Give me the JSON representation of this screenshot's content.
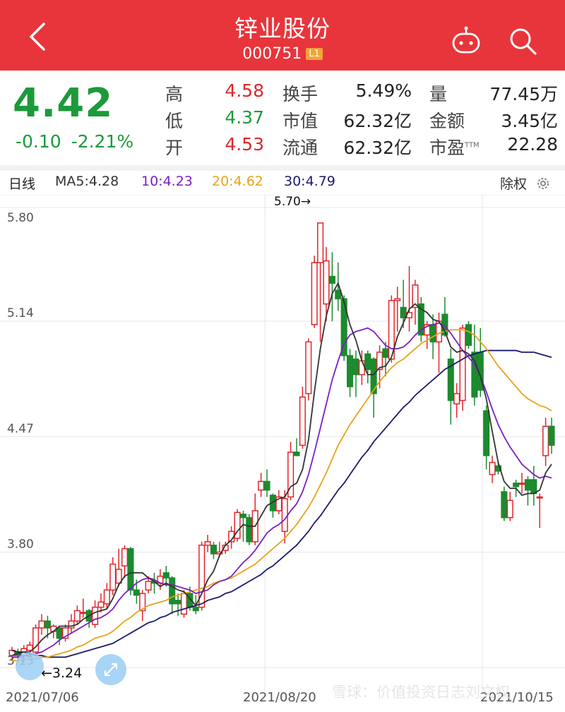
{
  "header": {
    "title": "锌业股份",
    "code": "000751",
    "badge": "L1",
    "bg_color": "#e8353b"
  },
  "quote": {
    "price": "4.42",
    "change": "-0.10",
    "change_pct": "-2.21%",
    "stats": [
      {
        "label": "高",
        "value": "4.58",
        "color": "red"
      },
      {
        "label": "低",
        "value": "4.37",
        "color": "green"
      },
      {
        "label": "开",
        "value": "4.53",
        "color": "red"
      },
      {
        "label": "换手",
        "value": "5.49%",
        "color": "black"
      },
      {
        "label": "市值",
        "value": "62.32亿",
        "color": "black"
      },
      {
        "label": "流通",
        "value": "62.32亿",
        "color": "black"
      },
      {
        "label": "量",
        "value": "77.45万",
        "color": "black"
      },
      {
        "label": "金额",
        "value": "3.45亿",
        "color": "black"
      },
      {
        "label": "市盈",
        "value": "22.28",
        "color": "black",
        "sup": "TTM"
      }
    ]
  },
  "legend": {
    "period": "日线",
    "ma5": "MA5:4.28",
    "ma10": "10:4.23",
    "ma20": "20:4.62",
    "ma30": "30:4.79",
    "adjust": "除权"
  },
  "watermark": "雪球：价值投资日志刘文权",
  "chart_data": {
    "type": "candlestick",
    "y_ticks": [
      "5.80",
      "5.14",
      "4.47",
      "3.80",
      "3.13"
    ],
    "ylim": [
      3.13,
      5.8
    ],
    "x_labels": [
      "2021/07/06",
      "2021/08/20",
      "2021/10/15"
    ],
    "high_marker": "5.70→",
    "low_marker": "←3.24",
    "colors": {
      "up": "#e0262d",
      "down": "#1c8a2e",
      "ma5": "#333333",
      "ma10": "#7b1fc2",
      "ma20": "#e8a317",
      "ma30": "#1a1a6e"
    },
    "candles": [
      [
        3.2,
        3.23,
        3.25,
        3.17
      ],
      [
        3.22,
        3.2,
        3.24,
        3.16
      ],
      [
        3.2,
        3.24,
        3.26,
        3.16
      ],
      [
        3.23,
        3.26,
        3.28,
        3.19
      ],
      [
        3.22,
        3.36,
        3.38,
        3.21
      ],
      [
        3.36,
        3.4,
        3.44,
        3.32
      ],
      [
        3.4,
        3.36,
        3.43,
        3.3
      ],
      [
        3.34,
        3.37,
        3.38,
        3.3
      ],
      [
        3.36,
        3.3,
        3.37,
        3.26
      ],
      [
        3.3,
        3.36,
        3.38,
        3.28
      ],
      [
        3.36,
        3.4,
        3.44,
        3.33
      ],
      [
        3.4,
        3.46,
        3.49,
        3.38
      ],
      [
        3.45,
        3.45,
        3.53,
        3.42
      ],
      [
        3.46,
        3.4,
        3.47,
        3.36
      ],
      [
        3.38,
        3.48,
        3.52,
        3.36
      ],
      [
        3.48,
        3.51,
        3.56,
        3.45
      ],
      [
        3.5,
        3.58,
        3.62,
        3.47
      ],
      [
        3.58,
        3.73,
        3.77,
        3.55
      ],
      [
        3.62,
        3.7,
        3.82,
        3.6
      ],
      [
        3.72,
        3.82,
        3.84,
        3.65
      ],
      [
        3.82,
        3.58,
        3.83,
        3.55
      ],
      [
        3.58,
        3.55,
        3.64,
        3.5
      ],
      [
        3.46,
        3.56,
        3.58,
        3.4
      ],
      [
        3.58,
        3.63,
        3.66,
        3.56
      ],
      [
        3.63,
        3.62,
        3.68,
        3.56
      ],
      [
        3.62,
        3.66,
        3.7,
        3.58
      ],
      [
        3.68,
        3.65,
        3.72,
        3.6
      ],
      [
        3.65,
        3.5,
        3.66,
        3.44
      ],
      [
        3.52,
        3.5,
        3.56,
        3.43
      ],
      [
        3.44,
        3.56,
        3.58,
        3.42
      ],
      [
        3.56,
        3.48,
        3.6,
        3.46
      ],
      [
        3.48,
        3.46,
        3.55,
        3.44
      ],
      [
        3.48,
        3.84,
        3.86,
        3.46
      ],
      [
        3.84,
        3.86,
        3.9,
        3.8
      ],
      [
        3.84,
        3.79,
        3.86,
        3.76
      ],
      [
        3.79,
        3.8,
        3.86,
        3.77
      ],
      [
        3.81,
        3.84,
        3.86,
        3.79
      ],
      [
        3.86,
        3.92,
        3.95,
        3.82
      ],
      [
        3.88,
        4.03,
        4.05,
        3.86
      ],
      [
        4.02,
        4.0,
        4.04,
        3.86
      ],
      [
        4.0,
        3.86,
        4.02,
        3.84
      ],
      [
        3.86,
        4.04,
        4.14,
        3.84
      ],
      [
        4.16,
        4.21,
        4.26,
        4.12
      ],
      [
        4.21,
        4.16,
        4.28,
        4.12
      ],
      [
        4.13,
        4.04,
        4.14,
        4.0
      ],
      [
        4.04,
        4.12,
        4.16,
        4.02
      ],
      [
        3.92,
        4.11,
        4.16,
        3.85
      ],
      [
        4.12,
        4.38,
        4.44,
        4.1
      ],
      [
        4.38,
        4.36,
        4.46,
        4.36
      ],
      [
        4.42,
        4.7,
        4.76,
        4.4
      ],
      [
        4.72,
        5.02,
        5.04,
        4.68
      ],
      [
        5.12,
        5.48,
        5.52,
        5.1
      ],
      [
        5.48,
        5.71,
        5.71,
        5.02
      ],
      [
        5.24,
        5.49,
        5.57,
        5.14
      ],
      [
        5.4,
        5.36,
        5.54,
        5.14
      ],
      [
        5.32,
        5.27,
        5.48,
        5.2
      ],
      [
        5.27,
        4.94,
        5.29,
        4.91
      ],
      [
        4.94,
        4.76,
        4.98,
        4.7
      ],
      [
        4.92,
        4.83,
        4.97,
        4.7
      ],
      [
        4.83,
        4.91,
        4.97,
        4.77
      ],
      [
        4.95,
        4.86,
        4.97,
        4.78
      ],
      [
        4.92,
        4.72,
        4.93,
        4.58
      ],
      [
        4.86,
        4.96,
        5.0,
        4.75
      ],
      [
        4.98,
        4.93,
        5.02,
        4.82
      ],
      [
        4.92,
        5.26,
        5.29,
        4.9
      ],
      [
        5.26,
        5.27,
        5.34,
        5.08
      ],
      [
        5.22,
        5.16,
        5.38,
        5.1
      ],
      [
        5.16,
        5.19,
        5.46,
        5.08
      ],
      [
        5.22,
        5.35,
        5.38,
        5.12
      ],
      [
        5.24,
        5.06,
        5.28,
        5.02
      ],
      [
        5.06,
        5.12,
        5.14,
        4.98
      ],
      [
        5.12,
        5.02,
        5.18,
        4.92
      ],
      [
        5.02,
        5.14,
        5.19,
        4.84
      ],
      [
        5.18,
        5.06,
        5.28,
        5.05
      ],
      [
        4.92,
        4.68,
        4.98,
        4.54
      ],
      [
        4.66,
        4.72,
        4.78,
        4.58
      ],
      [
        4.68,
        5.1,
        5.12,
        4.62
      ],
      [
        5.12,
        5.0,
        5.14,
        4.98
      ],
      [
        4.96,
        4.7,
        5.12,
        4.65
      ],
      [
        4.96,
        4.74,
        5.1,
        4.7
      ],
      [
        4.62,
        4.36,
        4.65,
        4.28
      ],
      [
        4.25,
        4.32,
        4.36,
        4.2
      ],
      [
        4.3,
        4.27,
        4.33,
        4.25
      ],
      [
        4.15,
        4.0,
        4.18,
        3.98
      ],
      [
        4.0,
        4.1,
        4.15,
        3.98
      ],
      [
        4.2,
        4.18,
        4.22,
        4.12
      ],
      [
        4.2,
        4.2,
        4.26,
        4.14
      ],
      [
        4.22,
        4.16,
        4.24,
        4.07
      ],
      [
        4.22,
        4.14,
        4.3,
        4.07
      ],
      [
        4.12,
        4.12,
        4.14,
        3.94
      ],
      [
        4.36,
        4.53,
        4.58,
        4.3
      ],
      [
        4.53,
        4.42,
        4.58,
        4.37
      ]
    ],
    "ma5": [
      3.2,
      3.21,
      3.22,
      3.22,
      3.25,
      3.29,
      3.32,
      3.34,
      3.37,
      3.37,
      3.37,
      3.38,
      3.41,
      3.43,
      3.45,
      3.46,
      3.47,
      3.53,
      3.61,
      3.66,
      3.68,
      3.68,
      3.68,
      3.65,
      3.63,
      3.6,
      3.62,
      3.6,
      3.58,
      3.57,
      3.53,
      3.49,
      3.56,
      3.64,
      3.69,
      3.78,
      3.84,
      3.87,
      3.92,
      3.96,
      3.95,
      3.95,
      4.01,
      4.07,
      4.09,
      4.11,
      4.12,
      4.18,
      4.2,
      4.28,
      4.45,
      4.73,
      4.98,
      5.17,
      5.3,
      5.36,
      5.25,
      5.12,
      5.03,
      4.91,
      4.83,
      4.83,
      4.87,
      4.88,
      4.93,
      5.05,
      5.13,
      5.21,
      5.24,
      5.21,
      5.19,
      5.15,
      5.14,
      5.08,
      4.99,
      4.96,
      4.97,
      4.95,
      4.91,
      4.82,
      4.69,
      4.5,
      4.32,
      4.21,
      4.17,
      4.17,
      4.13,
      4.14,
      4.14,
      4.16,
      4.26,
      4.31
    ],
    "ma10": [
      3.19,
      3.19,
      3.2,
      3.2,
      3.21,
      3.22,
      3.24,
      3.26,
      3.29,
      3.31,
      3.33,
      3.35,
      3.37,
      3.39,
      3.41,
      3.42,
      3.44,
      3.47,
      3.52,
      3.56,
      3.59,
      3.62,
      3.64,
      3.65,
      3.64,
      3.62,
      3.61,
      3.61,
      3.6,
      3.59,
      3.58,
      3.56,
      3.57,
      3.58,
      3.61,
      3.63,
      3.64,
      3.66,
      3.7,
      3.74,
      3.77,
      3.81,
      3.86,
      3.91,
      3.94,
      3.96,
      3.99,
      4.04,
      4.08,
      4.15,
      4.25,
      4.38,
      4.52,
      4.66,
      4.8,
      4.91,
      5.01,
      5.06,
      5.08,
      5.09,
      5.1,
      5.08,
      5.04,
      5.0,
      4.98,
      4.98,
      4.99,
      5.02,
      5.06,
      5.09,
      5.11,
      5.12,
      5.13,
      5.11,
      5.07,
      5.02,
      4.97,
      4.93,
      4.89,
      4.82,
      4.73,
      4.63,
      4.54,
      4.47,
      4.41,
      4.36,
      4.31,
      4.28,
      4.25,
      4.23,
      4.24,
      4.23
    ],
    "ma20": [
      3.17,
      3.17,
      3.18,
      3.18,
      3.18,
      3.19,
      3.19,
      3.2,
      3.21,
      3.22,
      3.23,
      3.25,
      3.26,
      3.28,
      3.3,
      3.31,
      3.32,
      3.34,
      3.37,
      3.4,
      3.42,
      3.45,
      3.47,
      3.49,
      3.5,
      3.51,
      3.52,
      3.54,
      3.55,
      3.56,
      3.57,
      3.58,
      3.59,
      3.6,
      3.62,
      3.63,
      3.64,
      3.65,
      3.67,
      3.69,
      3.71,
      3.73,
      3.76,
      3.79,
      3.82,
      3.85,
      3.88,
      3.92,
      3.96,
      4.01,
      4.06,
      4.12,
      4.19,
      4.26,
      4.34,
      4.42,
      4.48,
      4.54,
      4.59,
      4.64,
      4.69,
      4.74,
      4.79,
      4.83,
      4.87,
      4.9,
      4.92,
      4.95,
      4.98,
      5.01,
      5.03,
      5.05,
      5.07,
      5.08,
      5.09,
      5.09,
      5.09,
      5.08,
      5.06,
      5.02,
      4.98,
      4.93,
      4.88,
      4.84,
      4.8,
      4.76,
      4.72,
      4.69,
      4.67,
      4.65,
      4.64,
      4.62
    ],
    "ma30": [
      3.23,
      3.22,
      3.22,
      3.21,
      3.2,
      3.2,
      3.19,
      3.19,
      3.19,
      3.19,
      3.2,
      3.21,
      3.22,
      3.23,
      3.24,
      3.25,
      3.26,
      3.27,
      3.29,
      3.31,
      3.33,
      3.35,
      3.37,
      3.39,
      3.4,
      3.42,
      3.43,
      3.45,
      3.46,
      3.47,
      3.48,
      3.49,
      3.5,
      3.52,
      3.53,
      3.54,
      3.56,
      3.57,
      3.59,
      3.61,
      3.63,
      3.65,
      3.67,
      3.7,
      3.72,
      3.75,
      3.78,
      3.81,
      3.84,
      3.88,
      3.92,
      3.97,
      4.01,
      4.06,
      4.11,
      4.16,
      4.2,
      4.25,
      4.3,
      4.35,
      4.39,
      4.44,
      4.48,
      4.52,
      4.56,
      4.6,
      4.64,
      4.67,
      4.71,
      4.74,
      4.77,
      4.8,
      4.83,
      4.86,
      4.88,
      4.9,
      4.92,
      4.94,
      4.95,
      4.96,
      4.97,
      4.97,
      4.97,
      4.97,
      4.97,
      4.97,
      4.96,
      4.96,
      4.96,
      4.95,
      4.94,
      4.93
    ]
  }
}
